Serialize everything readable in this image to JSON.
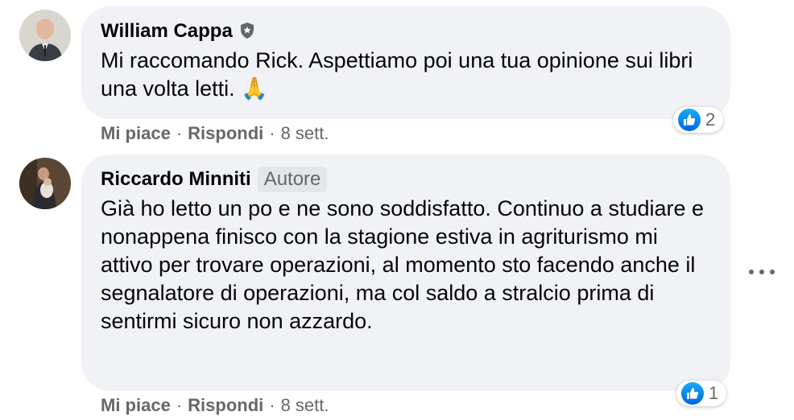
{
  "comments": [
    {
      "author": "William Cappa",
      "text": "Mi raccomando Rick. Aspettiamo poi una tua opinione sui libri una volta letti. 🙏",
      "like_label": "Mi piace",
      "reply_label": "Rispondi",
      "time": "8 sett.",
      "reaction_count": "2",
      "author_icon": "shield-icon"
    },
    {
      "author": "Riccardo Minniti",
      "badge": "Autore",
      "text": "Già ho letto un po e ne sono soddisfatto. Continuo a studiare e nonappena finisco con la stagione estiva in agriturismo mi attivo per trovare operazioni, al momento sto facendo anche il segnalatore di operazioni, ma col saldo a stralcio prima di sentirmi sicuro non azzardo.",
      "like_label": "Mi piace",
      "reply_label": "Rispondi",
      "time": "8 sett.",
      "reaction_count": "1"
    }
  ],
  "colors": {
    "bubble": "#f0f2f5",
    "secondary_text": "#65676b",
    "like_blue": "#0866ff"
  }
}
